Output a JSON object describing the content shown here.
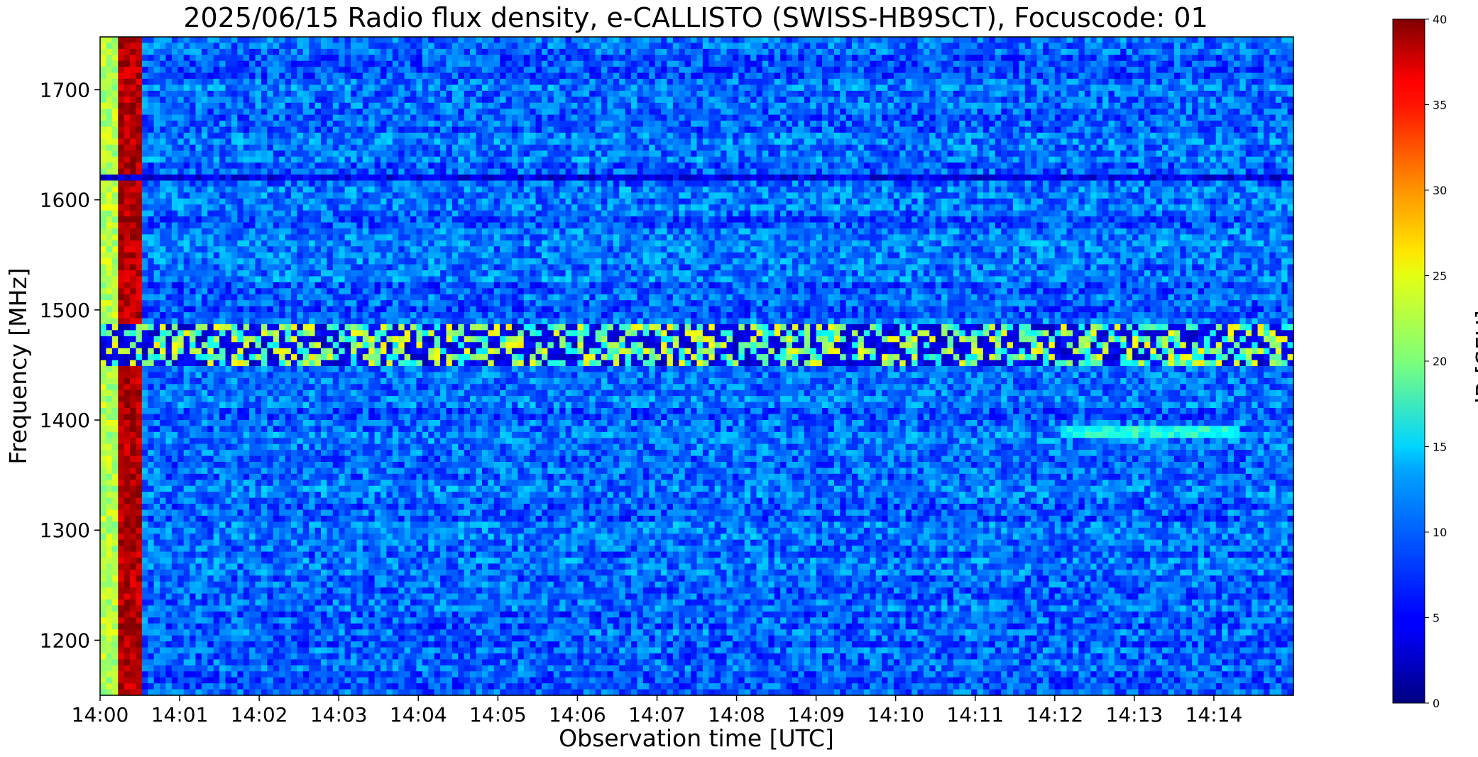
{
  "chart_data": {
    "type": "heatmap",
    "title": "2025/06/15  Radio flux density, e-CALLISTO (SWISS-HB9SCT), Focuscode: 01",
    "xlabel": "Observation time [UTC]",
    "ylabel": "Frequency [MHz]",
    "x_ticks": [
      "14:00",
      "14:01",
      "14:02",
      "14:03",
      "14:04",
      "14:05",
      "14:06",
      "14:07",
      "14:08",
      "14:09",
      "14:10",
      "14:11",
      "14:12",
      "14:13",
      "14:14"
    ],
    "x_range_minutes": [
      0,
      15
    ],
    "y_ticks": [
      1200,
      1300,
      1400,
      1500,
      1600,
      1700
    ],
    "ylim": [
      1150,
      1748
    ],
    "colorbar": {
      "label": "dB [SFU]",
      "ticks": [
        0,
        5,
        10,
        15,
        20,
        25,
        30,
        35,
        40
      ],
      "range": [
        0,
        40
      ],
      "colormap": "jet"
    },
    "background_level": 9,
    "features": [
      {
        "name": "calibration segment",
        "x_minutes": [
          0.0,
          0.25
        ],
        "level": 22
      },
      {
        "name": "calibration segment",
        "x_minutes": [
          0.25,
          0.52
        ],
        "level": 38
      },
      {
        "name": "interference band",
        "freq_mhz": [
          1450,
          1485
        ],
        "level": 14
      },
      {
        "name": "horizontal line",
        "freq_mhz": [
          1386,
          1392
        ],
        "x_minutes": [
          12.1,
          14.3
        ],
        "level": 16
      },
      {
        "name": "dark line",
        "freq_mhz": [
          1620,
          1623
        ],
        "level": 4
      }
    ]
  }
}
